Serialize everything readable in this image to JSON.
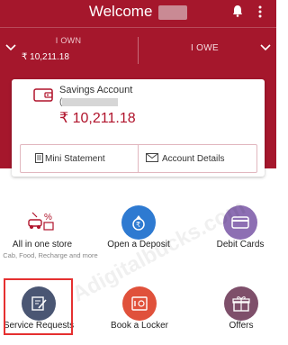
{
  "header": {
    "title": "Welcome"
  },
  "summary": {
    "own_label": "I OWN",
    "own_value": "₹ 10,211.18",
    "owe_label": "I OWE"
  },
  "account": {
    "name": "Savings Account",
    "number_prefix": "(",
    "balance": "₹ 10,211.18",
    "mini_statement": "Mini Statement",
    "account_details": "Account Details"
  },
  "services": [
    {
      "label": "All in one store",
      "sub": "Cab, Food, Recharge and more",
      "icon": "store-icon",
      "color": "#ffffff"
    },
    {
      "label": "Open a Deposit",
      "icon": "deposit-icon",
      "color": "#2e7ad1"
    },
    {
      "label": "Debit Cards",
      "icon": "debit-card-icon",
      "color": "#8d6fb3"
    },
    {
      "label": "Service Requests",
      "icon": "service-request-icon",
      "color": "#4a5673"
    },
    {
      "label": "Book a Locker",
      "icon": "locker-icon",
      "color": "#e0513b"
    },
    {
      "label": "Offers",
      "icon": "offers-icon",
      "color": "#7e4f6a"
    }
  ],
  "watermark": "Adigitalbucks.com"
}
